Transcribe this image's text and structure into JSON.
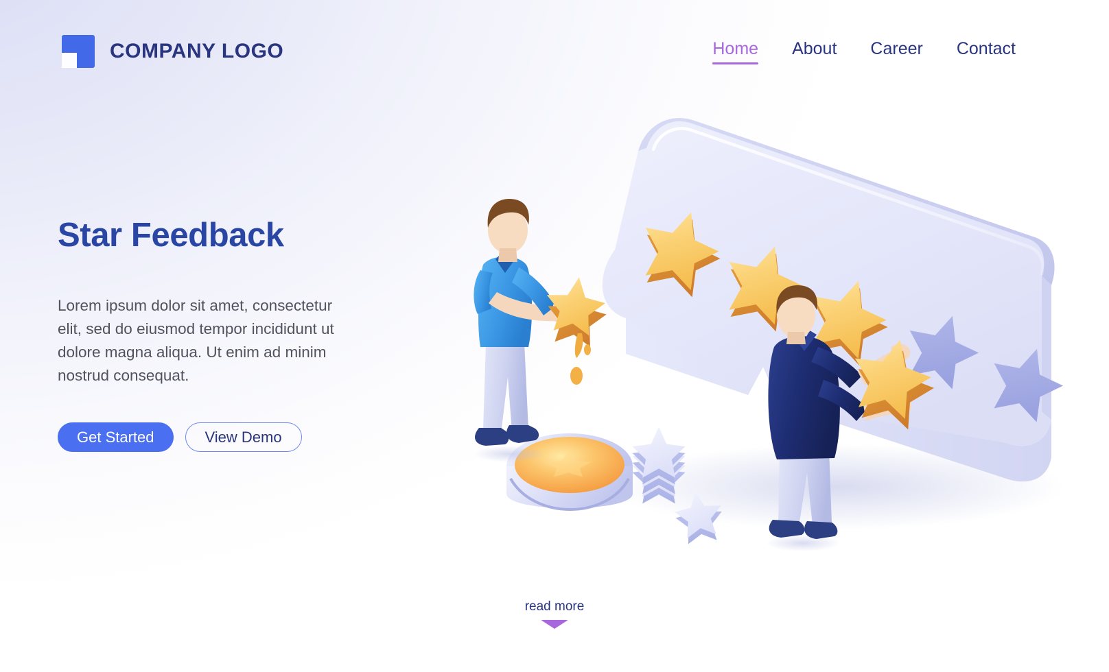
{
  "header": {
    "brand": {
      "logo_icon": "company-logo-mark",
      "name": "COMPANY LOGO"
    },
    "nav": [
      {
        "label": "Home",
        "active": true
      },
      {
        "label": "About",
        "active": false
      },
      {
        "label": "Career",
        "active": false
      },
      {
        "label": "Contact",
        "active": false
      }
    ]
  },
  "hero": {
    "title": "Star Feedback",
    "body": "Lorem ipsum dolor sit amet, consectetur elit, sed do eiusmod tempor incididunt ut dolore magna aliqua. Ut enim ad minim nostrud consequat.",
    "primary_button": "Get Started",
    "secondary_button": "View Demo"
  },
  "footer": {
    "read_more_label": "read more",
    "chevron_icon": "chevron-down-icon"
  },
  "illustration": {
    "name": "star-rating-isometric-illustration",
    "speech_bubble": "3d-speech-bubble",
    "rating": {
      "filled": 4,
      "total": 6
    },
    "characters": [
      {
        "name": "painter-in-blue-polo",
        "action": "dipping-star-in-paint"
      },
      {
        "name": "man-in-navy-suit",
        "action": "placing-gold-star"
      }
    ],
    "props": [
      "paint-bucket-with-gold-paint",
      "stack-of-unpainted-stars",
      "loose-unpainted-star"
    ]
  },
  "colors": {
    "brand_blue": "#4269e8",
    "navy": "#2a3580",
    "heading_blue": "#2a46a5",
    "accent_purple": "#a967de",
    "button_blue": "#4a6ff0",
    "body_text": "#52525e",
    "star_gold": "#f7cf6b",
    "star_gold_dark": "#e8992f",
    "bubble_face": "#e9eafb",
    "bubble_edge": "#c6c9ee",
    "empty_star": "#a3aae4",
    "suit_navy": "#1e2f77",
    "polo_blue": "#3a9ae8",
    "background_tint": "#d9dcf5"
  }
}
